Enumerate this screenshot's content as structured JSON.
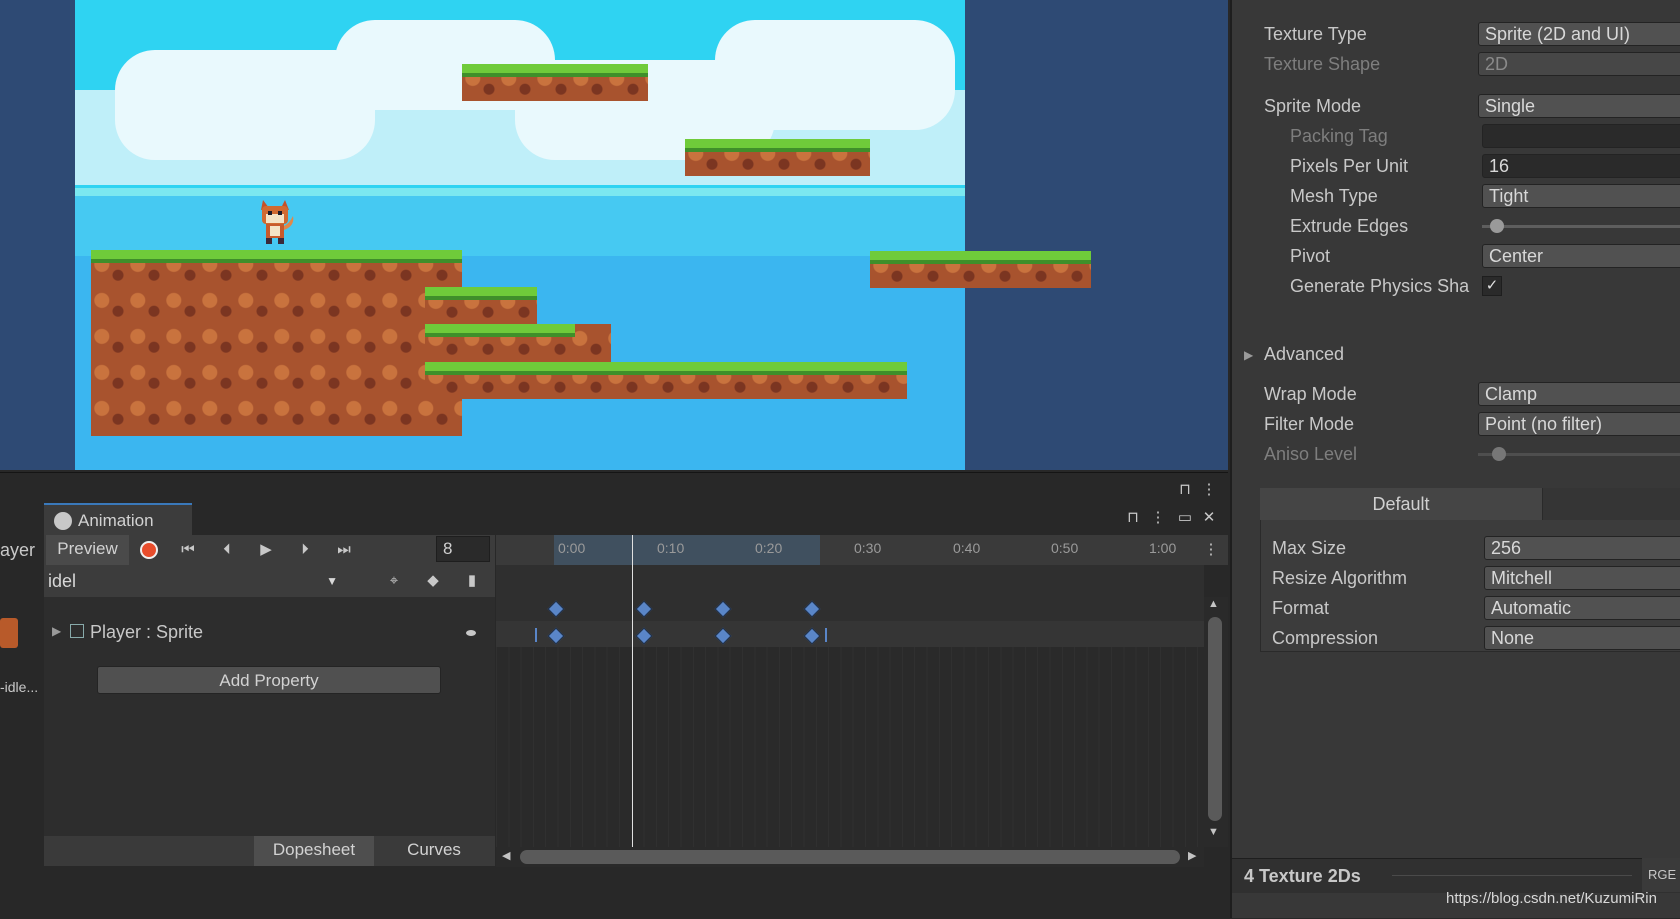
{
  "scene": {},
  "animation": {
    "tab_label": "Animation",
    "left_cut_text": "ayer",
    "preview_label": "Preview",
    "frame_value": "8",
    "clip_name": "idel",
    "property_label": "Player : Sprite",
    "add_property_label": "Add Property",
    "dopesheet_label": "Dopesheet",
    "curves_label": "Curves",
    "idle_cut_text": "-idle...",
    "timeline_ticks": [
      "0:00",
      "0:10",
      "0:20",
      "0:30",
      "0:40",
      "0:50",
      "1:00"
    ]
  },
  "inspector": {
    "texture_type_label": "Texture Type",
    "texture_type_value": "Sprite (2D and UI)",
    "texture_shape_label": "Texture Shape",
    "texture_shape_value": "2D",
    "sprite_mode_label": "Sprite Mode",
    "sprite_mode_value": "Single",
    "packing_tag_label": "Packing Tag",
    "packing_tag_value": "",
    "ppu_label": "Pixels Per Unit",
    "ppu_value": "16",
    "mesh_type_label": "Mesh Type",
    "mesh_type_value": "Tight",
    "extrude_label": "Extrude Edges",
    "pivot_label": "Pivot",
    "pivot_value": "Center",
    "gen_physics_label": "Generate Physics Sha",
    "advanced_label": "Advanced",
    "wrap_mode_label": "Wrap Mode",
    "wrap_mode_value": "Clamp",
    "filter_mode_label": "Filter Mode",
    "filter_mode_value": "Point (no filter)",
    "aniso_label": "Aniso Level",
    "default_tab": "Default",
    "max_size_label": "Max Size",
    "max_size_value": "256",
    "resize_label": "Resize Algorithm",
    "resize_value": "Mitchell",
    "format_label": "Format",
    "format_value": "Automatic",
    "compression_label": "Compression",
    "compression_value": "None",
    "footer_label": "4 Texture 2Ds",
    "footer_cut": "RGE"
  },
  "watermark": "https://blog.csdn.net/KuzumiRin"
}
